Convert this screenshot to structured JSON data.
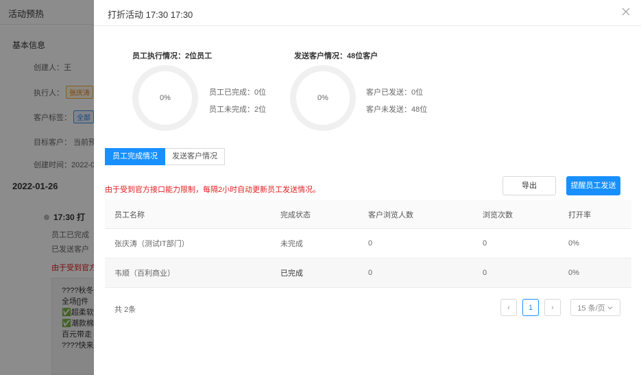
{
  "background": {
    "header_title": "活动预热",
    "section_title": "基本信息",
    "creator": "创建人：王",
    "executor_label": "执行人：",
    "executor_tag": "张庆涛",
    "customer_tag_label": "客户标签：",
    "customer_tag": "全部",
    "target_customer": "目标客户： 当前预",
    "create_time": "创建时间：2022-0",
    "date": "2022-01-26",
    "time_line": "17:30  打",
    "staff_done_line": "员工已完成（",
    "sent_line": "已发送客户（",
    "red_notice": "由于受到官方",
    "message_lines": [
      "????秋冬新",
      "全场[]件",
      "✅超柔软",
      "✅潮款棉",
      "百元带走",
      "????快来"
    ]
  },
  "drawer": {
    "title": "打折活动 17:30 17:30",
    "staff_stats": {
      "title": "员工执行情况：2位员工",
      "percent": "0%",
      "done": "员工已完成：0位",
      "undone": "员工未完成：2位"
    },
    "customer_stats": {
      "title": "发送客户情况：48位客户",
      "percent": "0%",
      "sent": "客户已发送：0位",
      "unsent": "客户未发送：48位"
    },
    "tabs": [
      {
        "label": "员工完成情况",
        "active": true
      },
      {
        "label": "发送客户情况",
        "active": false
      }
    ],
    "notice": "由于受到官方接口能力限制，每隔2小时自动更新员工发送情况。",
    "export_label": "导出",
    "remind_label": "提醒员工发送",
    "table": {
      "headers": [
        "员工名称",
        "完成状态",
        "客户浏览人数",
        "浏览次数",
        "打开率"
      ],
      "rows": [
        [
          "张庆涛（测试IT部门）",
          "未完成",
          "0",
          "0",
          "0%"
        ],
        [
          "韦顺（百利商业）",
          "已完成",
          "0",
          "0",
          "0%"
        ]
      ]
    },
    "pagination": {
      "total": "共 2条",
      "prev": "‹",
      "page": "1",
      "next": "›",
      "page_size": "15 条/页"
    }
  },
  "colors": {
    "primary": "#1890ff",
    "notice_red": "#e02020",
    "overlay": "rgba(0,0,0,0.45)"
  }
}
